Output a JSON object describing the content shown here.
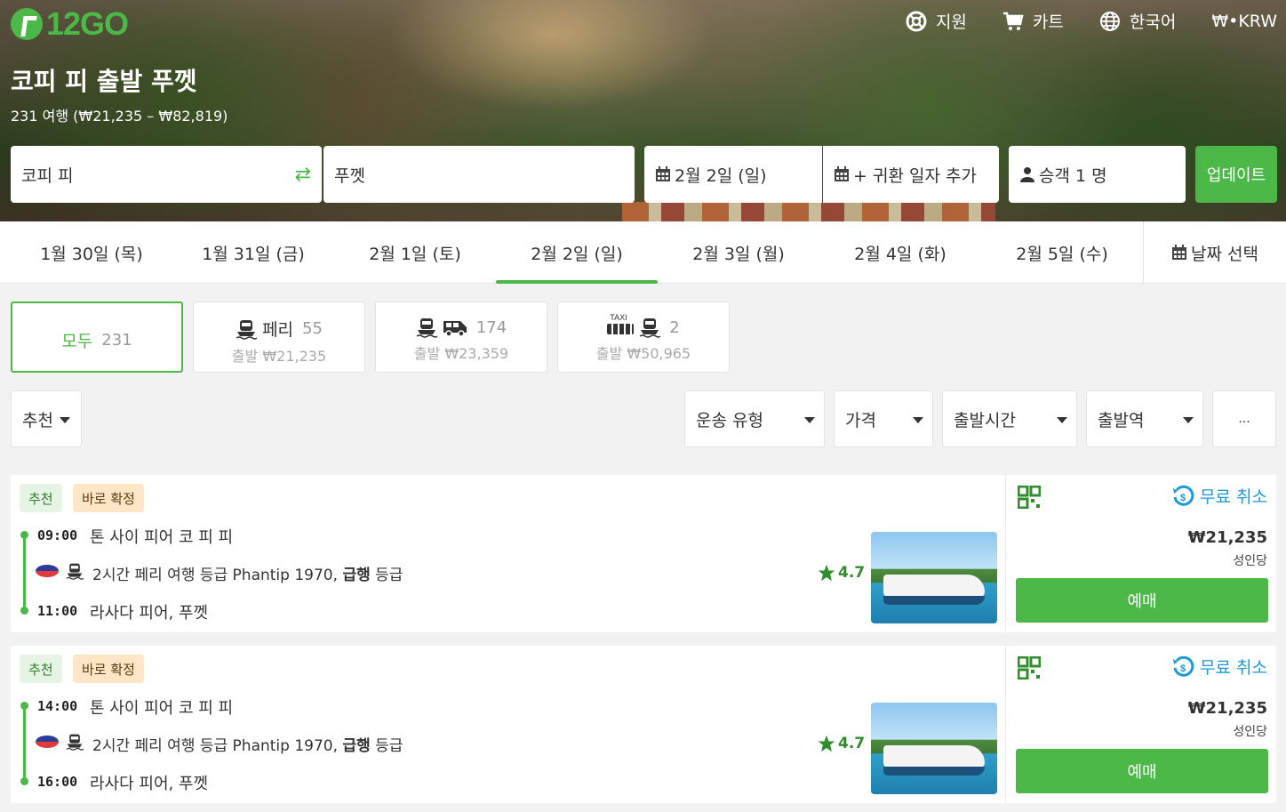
{
  "header": {
    "logo_text": "12GO",
    "nav": [
      {
        "label": "지원",
        "icon": "lifebuoy-icon"
      },
      {
        "label": "카트",
        "icon": "cart-icon"
      },
      {
        "label": "한국어",
        "icon": "globe-icon"
      },
      {
        "label": "₩•KRW",
        "icon": ""
      }
    ],
    "title": "코피 피 출발 푸껫",
    "subtitle": "231 여행 (₩21,235 – ₩82,819)"
  },
  "search": {
    "from": "코피 피",
    "to": "푸껫",
    "date": "2월 2일 (일)",
    "return": "+ 귀환 일자 추가",
    "passengers": "승객 1 명",
    "update_label": "업데이트"
  },
  "dates": {
    "tabs": [
      "1월 30일 (목)",
      "1월 31일 (금)",
      "2월 1일 (토)",
      "2월 2일 (일)",
      "2월 3일 (월)",
      "2월 4일 (화)",
      "2월 5일 (수)"
    ],
    "active_index": 3,
    "picker_label": "날짜 선택"
  },
  "types": [
    {
      "label": "모두",
      "count": "231",
      "price": ""
    },
    {
      "label": "페리",
      "count": "55",
      "price": "출발 ₩21,235"
    },
    {
      "label": "",
      "count": "174",
      "price": "출발 ₩23,359"
    },
    {
      "label": "",
      "count": "2",
      "price": "출발 ₩50,965",
      "taxi": "TAXI"
    }
  ],
  "filters": {
    "sort": "추천",
    "transport": "운송 유형",
    "price": "가격",
    "departure_time": "출발시간",
    "departure_station": "출발역",
    "more": "..."
  },
  "trips": [
    {
      "tag_rec": "추천",
      "tag_confirm": "바로 확정",
      "dep_time": "09:00",
      "dep_stop": "톤 사이 피어 코 피 피",
      "desc_pre": "2시간 페리 여행 등급 Phantip 1970, ",
      "desc_bold": "급행",
      "desc_post": " 등급",
      "arr_time": "11:00",
      "arr_stop": "라사다 피어, 푸껫",
      "rating": "4.7",
      "cancel": "무료 취소",
      "price": "₩21,235",
      "per": "성인당",
      "book": "예매"
    },
    {
      "tag_rec": "추천",
      "tag_confirm": "바로 확정",
      "dep_time": "14:00",
      "dep_stop": "톤 사이 피어 코 피 피",
      "desc_pre": "2시간 페리 여행 등급 Phantip 1970, ",
      "desc_bold": "급행",
      "desc_post": " 등급",
      "arr_time": "16:00",
      "arr_stop": "라사다 피어, 푸껫",
      "rating": "4.7",
      "cancel": "무료 취소",
      "price": "₩21,235",
      "per": "성인당",
      "book": "예매"
    }
  ],
  "colors": {
    "brand_green": "#4cb847",
    "cancel_blue": "#1a9ad6"
  }
}
